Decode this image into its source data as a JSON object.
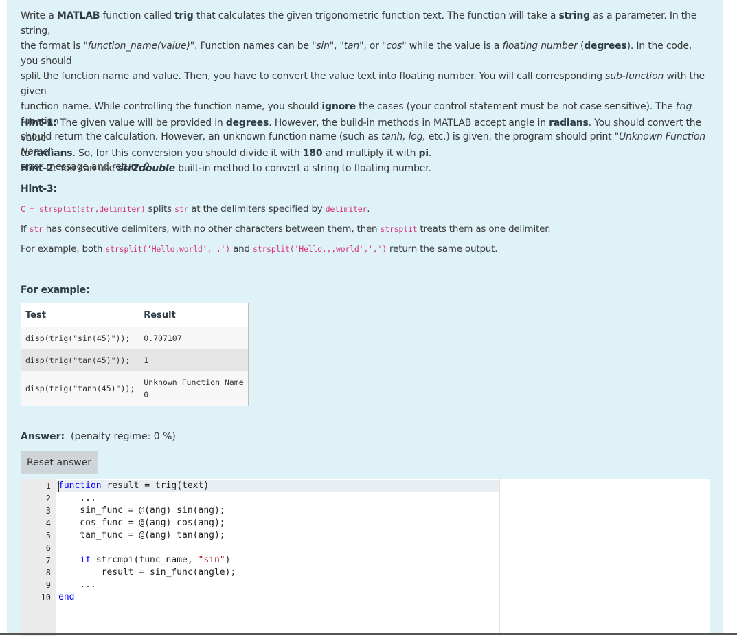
{
  "question": {
    "paragraph_lines": [
      [
        "Write a ",
        {
          "b": "MATLAB"
        },
        " function called ",
        {
          "b": "trig"
        },
        " that calculates the given trigonometric function text. The function will take a ",
        {
          "b": "string"
        },
        " as a parameter. In the string,"
      ],
      [
        "the format is \"",
        {
          "i": "function_name(value)"
        },
        "\". Function names can be \"",
        {
          "i": "sin"
        },
        "\", \"",
        {
          "i": "tan"
        },
        "\", or \"",
        {
          "i": "cos"
        },
        "\" while the value is a ",
        {
          "i": "floating number"
        },
        " (",
        {
          "b": "degrees"
        },
        "). In the code, you should"
      ],
      [
        "split the function name and value. Then, you have to convert the value text into floating number. You will call corresponding ",
        {
          "i": "sub-function"
        },
        " with the given"
      ],
      [
        "function name. While controlling the function name, you should ",
        {
          "b": "ignore"
        },
        " the cases (your control statement must be not case sensitive). The ",
        {
          "i": "trig"
        },
        " function"
      ],
      [
        "should return the calculation. However, an unknown function name (such as ",
        {
          "i": "tanh, log,"
        },
        " etc.) is given, the program should print \"",
        {
          "i": "Unknown Function Name"
        },
        "\""
      ],
      [
        "error message and return ",
        {
          "i": "0."
        }
      ]
    ],
    "hint1_lines": [
      [
        {
          "h": "Hint-1:"
        },
        " The given value will be provided in ",
        {
          "b": "degrees"
        },
        ". However, the build-in methods in MATLAB accept angle in ",
        {
          "b": "radians"
        },
        ". You should convert the value"
      ],
      [
        "to ",
        {
          "b": "radians"
        },
        ". So, for this conversion you should divide it with ",
        {
          "b": "180"
        },
        " and multiply it with ",
        {
          "b": "pi"
        },
        "."
      ]
    ],
    "hint2": [
      {
        "h": "Hint-2"
      },
      ": You can use ",
      {
        "bi": "str2double"
      },
      " built-in method to convert a string to floating number."
    ],
    "hint3_title": "Hint-3:",
    "hint3_line1": [
      {
        "m": "C = strsplit(str,delimiter)"
      },
      " splits ",
      {
        "m": "str"
      },
      " at the delimiters specified by ",
      {
        "m": "delimiter"
      },
      "."
    ],
    "hint3_line2": [
      "If ",
      {
        "m": "str"
      },
      " has consecutive delimiters, with no other characters between them, then ",
      {
        "m": "strsplit"
      },
      " treats them as one delimiter."
    ],
    "hint3_line3": [
      "For example, both ",
      {
        "m": "strsplit('Hello,world',',')"
      },
      " and ",
      {
        "m": "strsplit('Hello,,,world',',')"
      },
      " return the same output."
    ]
  },
  "example_heading": "For example:",
  "example_table": {
    "headers": [
      "Test",
      "Result"
    ],
    "rows": [
      {
        "test": "disp(trig(\"sin(45)\"));",
        "result": [
          "0.707107"
        ]
      },
      {
        "test": "disp(trig(\"tan(45)\"));",
        "result": [
          "1"
        ]
      },
      {
        "test": "disp(trig(\"tanh(45)\"));",
        "result": [
          "Unknown Function Name",
          "0"
        ]
      }
    ]
  },
  "answer": {
    "label": "Answer:",
    "penalty": "(penalty regime: 0 %)",
    "reset_button": "Reset answer"
  },
  "editor": {
    "line_numbers": [
      "1",
      "2",
      "3",
      "4",
      "5",
      "6",
      "7",
      "8",
      "9",
      "10"
    ],
    "lines": [
      [
        {
          "kw": "function"
        },
        " result = trig(text)"
      ],
      [
        "    ..."
      ],
      [
        "    sin_func = @(ang) sin(ang);"
      ],
      [
        "    cos_func = @(ang) cos(ang);"
      ],
      [
        "    tan_func = @(ang) tan(ang);"
      ],
      [
        ""
      ],
      [
        "    ",
        {
          "kw": "if"
        },
        " strcmpi(func_name, ",
        {
          "str": "\"sin\""
        },
        ")"
      ],
      [
        "        result = sin_func(angle);"
      ],
      [
        "    ..."
      ],
      [
        {
          "kw": "end"
        }
      ]
    ]
  }
}
